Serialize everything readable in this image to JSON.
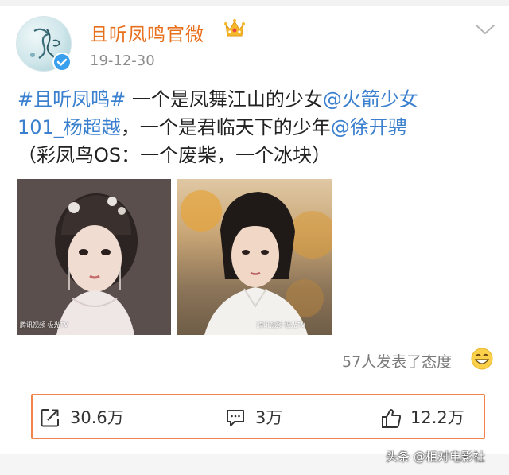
{
  "post": {
    "author": "且听凤鸣官微",
    "time": "19-12-30",
    "text": {
      "topic": "#且听凤鸣#",
      "part1": "一个是凤舞江山的少女",
      "mention1_a": "@火箭少女",
      "mention1_b": "101_杨超越",
      "part2": "，一个是君临天下的少年",
      "mention2": "@徐开骋",
      "part3": "（彩凤鸟OS：一个废柴，一个冰块）"
    },
    "images": [
      {
        "watermark": "腾讯视频 极光TV"
      },
      {
        "watermark": "腾讯视频 极光TV"
      }
    ],
    "reactions_text": "57人发表了态度",
    "actions": {
      "repost": "30.6万",
      "comment": "3万",
      "like": "12.2万"
    }
  },
  "footer": {
    "watermark": "头条 @相对电影社"
  },
  "colors": {
    "author": "#e8701d",
    "link": "#3b80cf",
    "highlight_border": "#f0844a",
    "verified": "#3aa0ee"
  },
  "icons": [
    "avatar-logo",
    "verified-icon",
    "crown-icon",
    "chevron-down-icon",
    "emoji-icon",
    "repost-icon",
    "comment-icon",
    "like-icon"
  ]
}
